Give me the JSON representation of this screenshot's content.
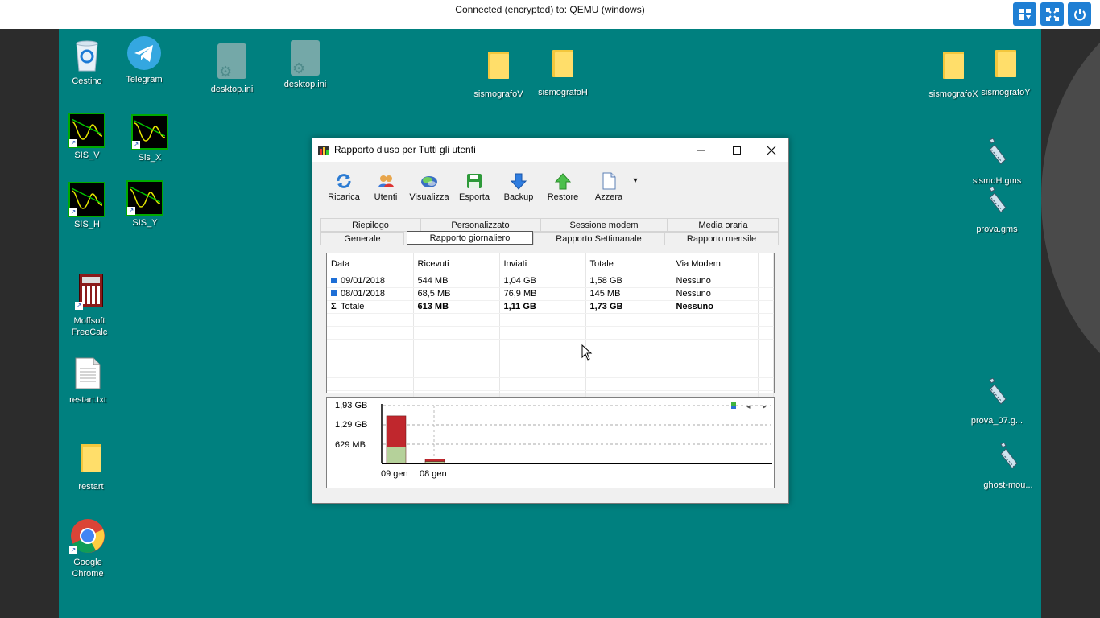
{
  "vnc": {
    "status": "Connected (encrypted) to: QEMU (windows)"
  },
  "desktop": {
    "icons": {
      "cestino": "Cestino",
      "telegram": "Telegram",
      "desktop_ini_1": "desktop.ini",
      "desktop_ini_2": "desktop.ini",
      "sismografoV": "sismografoV",
      "sismografoH": "sismografoH",
      "sismografoX": "sismografoX",
      "sismografoY": "sismografoY",
      "sis_v": "SIS_V",
      "sis_x": "Sis_X",
      "sis_h": "SIS_H",
      "sis_y": "SIS_Y",
      "moffsoft": "Moffsoft FreeCalc",
      "restart_txt": "restart.txt",
      "restart": "restart",
      "chrome": "Google Chrome",
      "sismoh_gms": "sismoH.gms",
      "prova_gms": "prova.gms",
      "prova_07": "prova_07.g...",
      "ghost_mou": "ghost-mou..."
    }
  },
  "window": {
    "title": "Rapporto d'uso per Tutti gli utenti",
    "toolbar": [
      "Ricarica",
      "Utenti",
      "Visualizza",
      "Esporta",
      "Backup",
      "Restore",
      "Azzera"
    ],
    "tabs_row1": [
      "Riepilogo",
      "Personalizzato",
      "Sessione modem",
      "Media oraria"
    ],
    "tabs_row2": [
      "Generale",
      "Rapporto giornaliero",
      "Rapporto Settimanale",
      "Rapporto mensile"
    ],
    "active_tab": "Rapporto giornaliero",
    "table": {
      "headers": [
        "Data",
        "Ricevuti",
        "Inviati",
        "Totale",
        "Via Modem"
      ],
      "rows": [
        [
          "09/01/2018",
          "544 MB",
          "1,04 GB",
          "1,58 GB",
          "Nessuno"
        ],
        [
          "08/01/2018",
          "68,5 MB",
          "76,9 MB",
          "145 MB",
          "Nessuno"
        ]
      ],
      "total": [
        "Totale",
        "613 MB",
        "1,11 GB",
        "1,73 GB",
        "Nessuno"
      ]
    }
  },
  "chart_data": {
    "type": "bar",
    "categories": [
      "09 gen",
      "08 gen"
    ],
    "series": [
      {
        "name": "Ricevuti",
        "values": [
          0.544,
          0.0685
        ],
        "color": "#b5d19a"
      },
      {
        "name": "Inviati",
        "values": [
          1.04,
          0.0769
        ],
        "color": "#c0272d"
      }
    ],
    "yticks": [
      "1,93 GB",
      "1,29 GB",
      "629 MB"
    ],
    "ylim": [
      0,
      1.93
    ],
    "xlabel": "",
    "ylabel": ""
  }
}
